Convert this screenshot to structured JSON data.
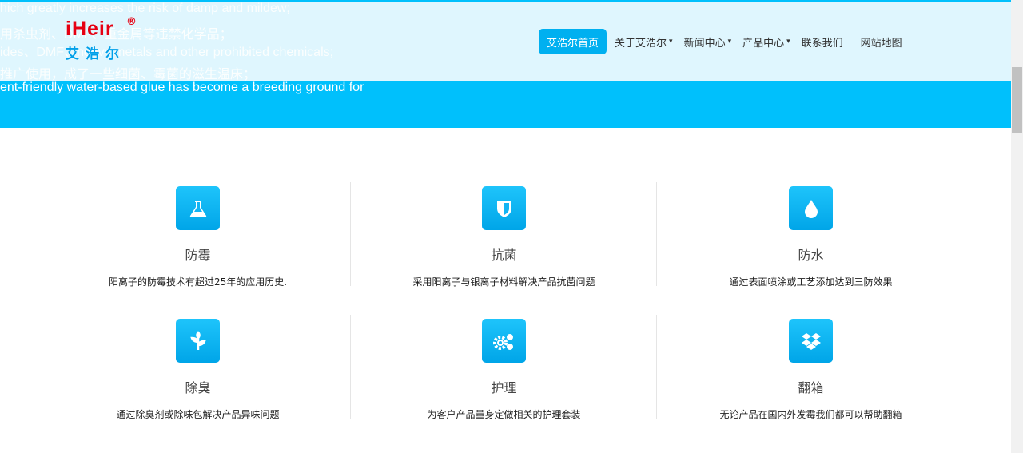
{
  "hero": {
    "lines": [
      "hich greatly increases the risk of damp and mildew;",
      "用杀虫剂、DMF、重金属等违禁化学品；",
      "ides、DMF、heavy metals and other prohibited chemicals;",
      "推广使用，成了一些细菌、霉菌的滋生温床；",
      "ent-friendly water-based glue has become a breeding ground for"
    ]
  },
  "logo": {
    "en": "iHeir",
    "reg": "®",
    "cn": "艾浩尔"
  },
  "nav": [
    {
      "label": "艾浩尔首页",
      "active": true
    },
    {
      "label": "关于艾浩尔",
      "dropdown": true
    },
    {
      "label": "新闻中心",
      "dropdown": true
    },
    {
      "label": "产品中心",
      "dropdown": true
    },
    {
      "label": "联系我们"
    },
    {
      "label": "网站地图"
    }
  ],
  "features": [
    {
      "icon": "flask-icon",
      "title": "防霉",
      "desc": "阳离子的防霉技术有超过25年的应用历史."
    },
    {
      "icon": "shield-icon",
      "title": "抗菌",
      "desc": "采用阳离子与银离子材料解决产品抗菌问题"
    },
    {
      "icon": "water-drop-icon",
      "title": "防水",
      "desc": "通过表面喷涂或工艺添加达到三防效果"
    },
    {
      "icon": "leaf-icon",
      "title": "除臭",
      "desc": "通过除臭剂或除味包解决产品异味问题"
    },
    {
      "icon": "gears-icon",
      "title": "护理",
      "desc": "为客户产品量身定做相关的护理套装"
    },
    {
      "icon": "dropbox-icon",
      "title": "翻箱",
      "desc": "无论产品在国内外发霉我们都可以帮助翻箱"
    }
  ],
  "colors": {
    "accent": "#00c0fc",
    "brand_red": "#e60012",
    "brand_blue": "#00a0e9"
  }
}
